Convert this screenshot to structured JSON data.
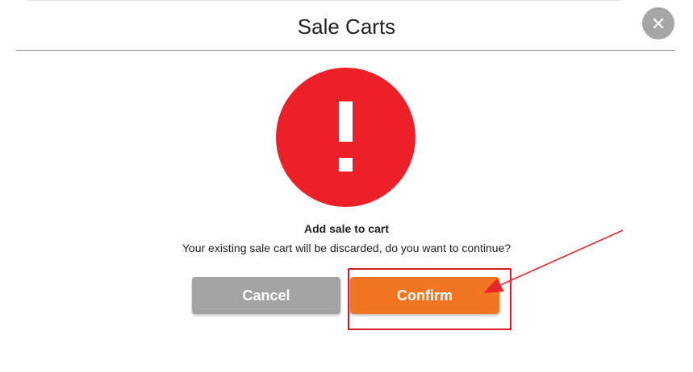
{
  "dialog": {
    "title": "Sale Carts",
    "close_icon": "close-icon"
  },
  "alert": {
    "icon": "exclamation-icon",
    "heading": "Add sale to cart",
    "message": "Your existing sale cart will be discarded, do you want to continue?"
  },
  "actions": {
    "cancel_label": "Cancel",
    "confirm_label": "Confirm"
  },
  "annotation": {
    "highlight_color": "#d81b25",
    "arrow_icon": "pointer-arrow"
  },
  "colors": {
    "alert_red": "#ec2028",
    "confirm_orange": "#f27521",
    "cancel_gray": "#a3a3a3",
    "close_gray": "#a6a6a6"
  }
}
